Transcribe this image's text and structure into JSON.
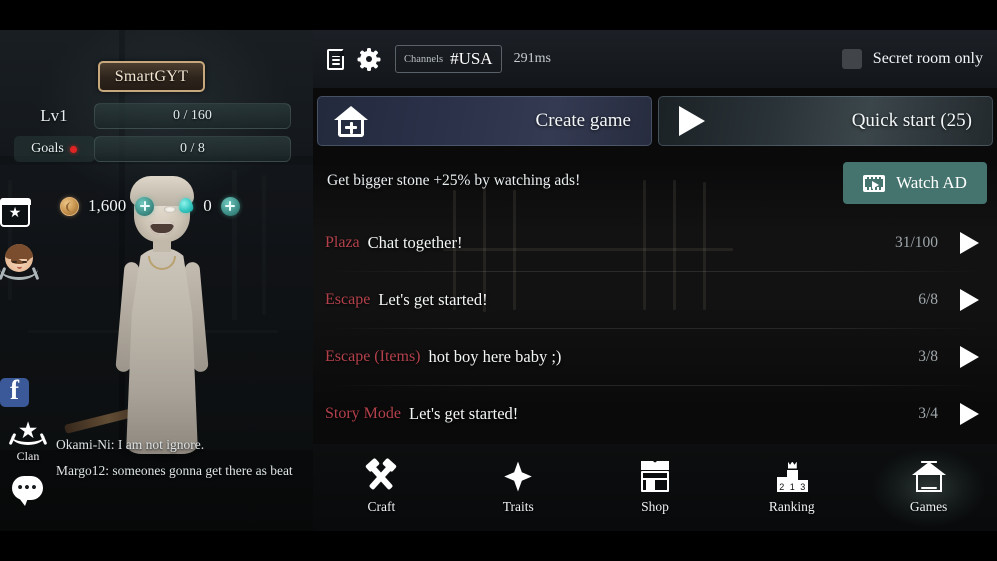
{
  "profile": {
    "username": "SmartGYT",
    "level_label": "Lv1",
    "level_progress": "0 / 160",
    "goals_label": "Goals",
    "goals_progress": "0 / 8",
    "coins": "1,600",
    "gems": "0",
    "add_label": "+"
  },
  "rail": {
    "calendar_icon": "calendar-star-icon",
    "avatar_icon": "avatar-laurel-icon",
    "facebook_icon": "facebook-icon",
    "clan_label": "Clan",
    "chat_icon": "chat-bubble-icon"
  },
  "chat": {
    "messages": [
      "Okami-Ni: I am not ignore.",
      "Margo12: someones gonna get there as beat"
    ]
  },
  "topbar": {
    "notes_icon": "document-icon",
    "settings_icon": "gear-icon",
    "channel_label": "Channels",
    "channel_value": "#USA",
    "ping": "291ms",
    "secret_room_label": "Secret room only",
    "secret_room_checked": false
  },
  "actions": {
    "create_game": "Create game",
    "quick_start": "Quick start (25)"
  },
  "ad": {
    "text": "Get bigger stone +25% by watching ads!",
    "button": "Watch AD",
    "icon": "film-icon"
  },
  "rooms": [
    {
      "category": "Plaza",
      "title": "Chat together!",
      "count": "31/100"
    },
    {
      "category": "Escape",
      "title": "Let's get started!",
      "count": "6/8"
    },
    {
      "category": "Escape (Items)",
      "title": "hot boy here baby ;)",
      "count": "3/8"
    },
    {
      "category": "Story Mode",
      "title": "Let's get started!",
      "count": "3/4"
    }
  ],
  "nav": [
    {
      "label": "Craft",
      "icon": "hammers-icon",
      "active": false
    },
    {
      "label": "Traits",
      "icon": "star-icon",
      "active": false
    },
    {
      "label": "Shop",
      "icon": "store-icon",
      "active": false
    },
    {
      "label": "Ranking",
      "icon": "podium-icon",
      "active": false
    },
    {
      "label": "Games",
      "icon": "house-icon",
      "active": true
    }
  ],
  "colors": {
    "accent_teal": "#45746e",
    "category_red": "#b3414b",
    "name_border": "#c6a87c",
    "goals_dot": "#e02424"
  }
}
